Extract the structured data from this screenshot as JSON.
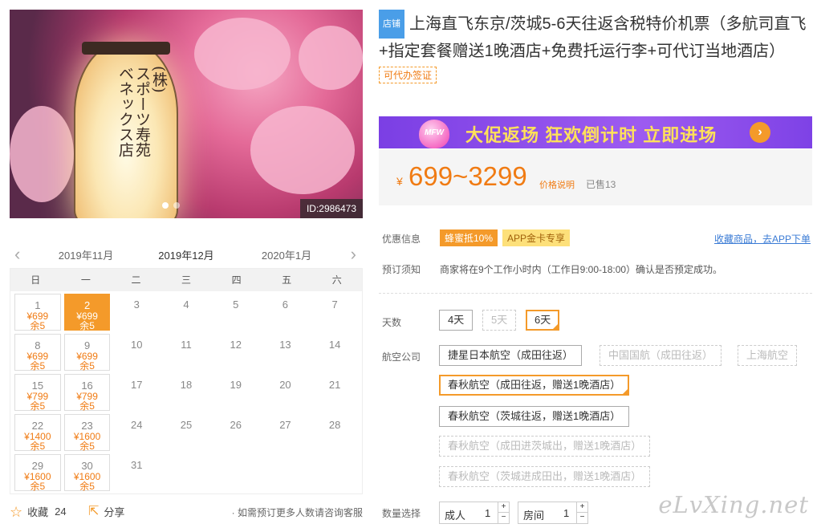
{
  "hero": {
    "lantern_text": "(株)\nスポーツ寿苑\nベネックス店",
    "image_id": "ID:2986473"
  },
  "calendar": {
    "months": [
      "2019年11月",
      "2019年12月",
      "2020年1月"
    ],
    "weekdays": [
      "日",
      "一",
      "二",
      "三",
      "四",
      "五",
      "六"
    ],
    "days": [
      {
        "day": "1",
        "price": "¥699",
        "stock": "余5"
      },
      {
        "day": "2",
        "price": "¥699",
        "stock": "余5",
        "selected": true
      },
      {
        "day": "3"
      },
      {
        "day": "4"
      },
      {
        "day": "5"
      },
      {
        "day": "6"
      },
      {
        "day": "7"
      },
      {
        "day": "8",
        "price": "¥699",
        "stock": "余5"
      },
      {
        "day": "9",
        "price": "¥699",
        "stock": "余5"
      },
      {
        "day": "10"
      },
      {
        "day": "11"
      },
      {
        "day": "12"
      },
      {
        "day": "13"
      },
      {
        "day": "14"
      },
      {
        "day": "15",
        "price": "¥799",
        "stock": "余5"
      },
      {
        "day": "16",
        "price": "¥799",
        "stock": "余5"
      },
      {
        "day": "17"
      },
      {
        "day": "18"
      },
      {
        "day": "19"
      },
      {
        "day": "20"
      },
      {
        "day": "21"
      },
      {
        "day": "22",
        "price": "¥1400",
        "stock": "余5"
      },
      {
        "day": "23",
        "price": "¥1600",
        "stock": "余5"
      },
      {
        "day": "24"
      },
      {
        "day": "25"
      },
      {
        "day": "26"
      },
      {
        "day": "27"
      },
      {
        "day": "28"
      },
      {
        "day": "29",
        "price": "¥1600",
        "stock": "余5"
      },
      {
        "day": "30",
        "price": "¥1600",
        "stock": "余5"
      },
      {
        "day": "31"
      }
    ]
  },
  "actions": {
    "favorite_label": "收藏",
    "favorite_count": "24",
    "share_label": "分享",
    "note": "· 如需预订更多人数请咨询客服"
  },
  "product": {
    "shop_badge": "店铺",
    "title": "上海直飞东京/茨城5-6天往返含税特价机票（多航司直飞+指定套餐赠送1晚酒店+免费托运行李+可代订当地酒店）",
    "visa_tag": "可代办签证"
  },
  "banner": {
    "badge": "MFW",
    "text": "大促返场 狂欢倒计时 立即进场",
    "arrow": "›"
  },
  "price": {
    "currency": "¥",
    "range": "699~3299",
    "explain": "价格说明",
    "sold": "已售13"
  },
  "info": {
    "promo_label": "优惠信息",
    "promo_tags": [
      "蜂蜜抵10%",
      "APP金卡专享"
    ],
    "collect_app": "收藏商品，去APP下单",
    "notice_label": "预订须知",
    "notice_text": "商家将在9个工作小时内（工作日9:00-18:00）确认是否预定成功。"
  },
  "options": {
    "days_label": "天数",
    "days": [
      "4天",
      "5天",
      "6天"
    ],
    "airline_label": "航空公司",
    "airlines": [
      "捷星日本航空（成田往返）",
      "中国国航（成田往返）",
      "上海航空",
      "春秋航空（成田往返，赠送1晚酒店）",
      "春秋航空（茨城往返，赠送1晚酒店）",
      "春秋航空（成田进茨城出，赠送1晚酒店）",
      "春秋航空（茨城进成田出，赠送1晚酒店）"
    ],
    "qty_label": "数量选择",
    "qty": [
      {
        "name": "成人",
        "value": "1"
      },
      {
        "name": "房间",
        "value": "1"
      }
    ]
  },
  "watermark": "eLvXing.net",
  "colors": {
    "accent": "#f49a2a",
    "price": "#f07b13",
    "banner": "#8a4be8"
  }
}
